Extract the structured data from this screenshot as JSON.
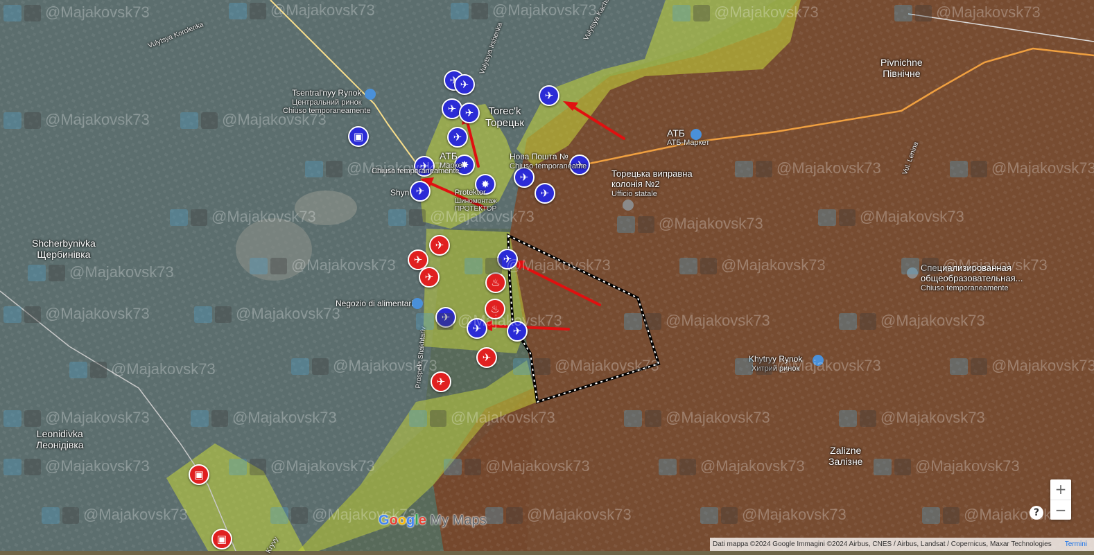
{
  "map": {
    "cities": [
      {
        "latin": "Pivnichne",
        "cyr": "Північне"
      },
      {
        "latin": "Torec'k",
        "cyr": "Торецьк"
      },
      {
        "latin": "Shcherbynivka",
        "cyr": "Щербинівка"
      },
      {
        "latin": "Leonidivka",
        "cyr": "Леонідівка"
      },
      {
        "latin": "Zalizne",
        "cyr": "Залізне"
      }
    ],
    "pois": {
      "central_market": {
        "name": "Tsentral'nyy Rynok",
        "sub": "Центральний ринок",
        "status": "Chiuso temporaneamente"
      },
      "atb_market_east": {
        "name": "АТБ",
        "sub": "АТБ-Маркет"
      },
      "atb_market_west": {
        "name": "АТБ",
        "sub": "Марке"
      },
      "nova_poshta": {
        "name": "Нова Пошта №",
        "status": "Chiuso temporaneame"
      },
      "colony": {
        "name": "Торецька виправна",
        "name2": "колонія №2",
        "sub": "Ufficio statale"
      },
      "special_school": {
        "name": "Специализированная",
        "name2": "общеобразовательная...",
        "status": "Chiuso temporaneamente"
      },
      "grocery": {
        "name": "Negozio di alimentari"
      },
      "khytryy_rynok": {
        "name": "Khytryy Rynok",
        "sub": "Хитрий ринок"
      },
      "shynomontazh": {
        "name": "Shyn",
        "name_tail": "Protektor",
        "sub": "Шиномонтаж",
        "sub2": "ПРОТЕКТОР"
      },
      "west_market_status": {
        "status": "Chiuso temporaneamente"
      }
    },
    "streets": {
      "korolenka": "Vulytsya Korolenka",
      "kachalova": "Vulytsya Kachalova",
      "pobedy": "Vulytsya Irshenka",
      "lenina": "Vul. Lenina",
      "shakhtariv": "Prospekt Shakhtariv",
      "kryvy": "Kryvy"
    },
    "watermark": "@Majakovsk73",
    "colors": {
      "russian_zone": "#7a4a2e",
      "contested_zone": "#c9d83a",
      "ukrainian_unit": "#2b2bd6",
      "strike_marker": "#e02020",
      "arrow": "#e01010",
      "road_major": "#f0a040"
    },
    "markers": {
      "drone": "drone-marker",
      "aircraft": "aircraft-marker",
      "fire": "fire-marker",
      "tank": "tank-marker",
      "artillery": "artillery-marker"
    }
  },
  "controls": {
    "zoom_in": "+",
    "zoom_out": "−",
    "help": "?"
  },
  "branding": {
    "google": [
      "G",
      "o",
      "o",
      "g",
      "l",
      "e"
    ],
    "my_maps": "My Maps"
  },
  "attribution": {
    "text": "Dati mappa ©2024 Google Immagini ©2024 Airbus, CNES / Airbus, Landsat / Copernicus, Maxar Technologies",
    "terms": "Termini"
  }
}
